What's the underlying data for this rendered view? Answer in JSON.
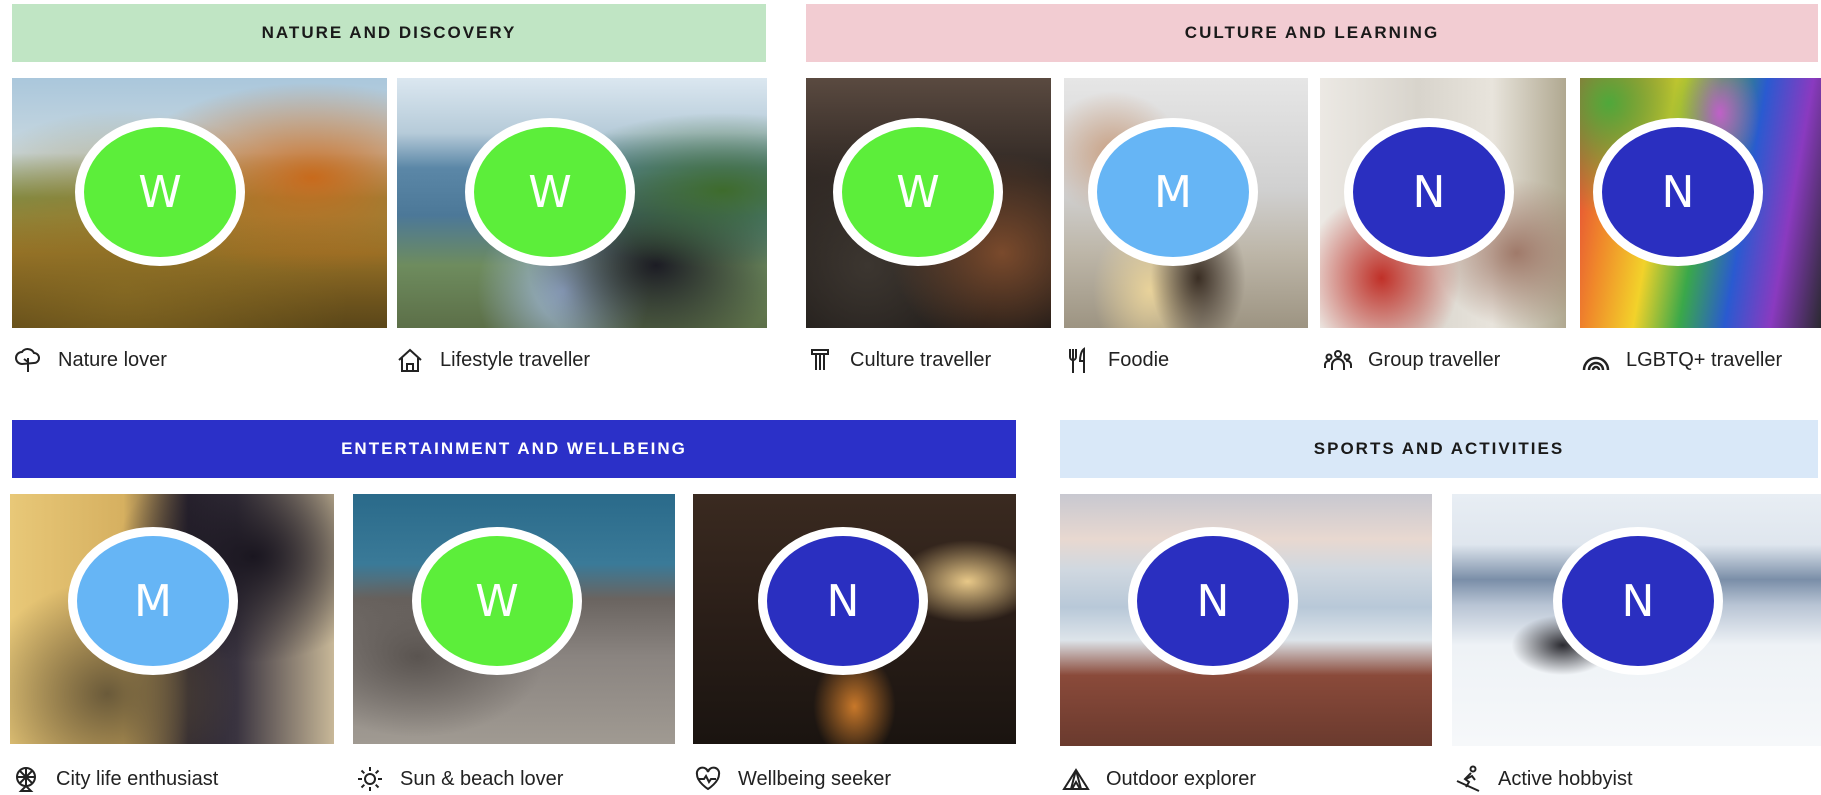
{
  "colors": {
    "nature_banner": "#c0e5c4",
    "culture_banner": "#f2ccd2",
    "entertainment_banner": "#2b30c8",
    "sports_banner": "#d9e8f8",
    "badge_W": "#5cee3a",
    "badge_M": "#66b5f5",
    "badge_N": "#2a2fc0"
  },
  "categories": {
    "nature": "NATURE AND DISCOVERY",
    "culture": "CULTURE AND LEARNING",
    "entertainment": "ENTERTAINMENT AND WELLBEING",
    "sports": "SPORTS AND ACTIVITIES"
  },
  "travellers": [
    {
      "label": "Nature lover",
      "badge": "W",
      "icon": "tree-icon",
      "photo": "autumn lakeside bench"
    },
    {
      "label": "Lifestyle traveller",
      "badge": "W",
      "icon": "house-icon",
      "photo": "couple selfie by sea"
    },
    {
      "label": "Culture traveller",
      "badge": "W",
      "icon": "column-icon",
      "photo": "theatre audience"
    },
    {
      "label": "Foodie",
      "badge": "M",
      "icon": "fork-knife-icon",
      "photo": "dining table"
    },
    {
      "label": "Group traveller",
      "badge": "N",
      "icon": "group-icon",
      "photo": "friends in street"
    },
    {
      "label": "LGBTQ+ traveller",
      "badge": "N",
      "icon": "rainbow-icon",
      "photo": "pride parade"
    },
    {
      "label": "City life enthusiast",
      "badge": "M",
      "icon": "ferris-wheel-icon",
      "photo": "evening city street"
    },
    {
      "label": "Sun & beach lover",
      "badge": "W",
      "icon": "sun-icon",
      "photo": "rocky seashore"
    },
    {
      "label": "Wellbeing seeker",
      "badge": "N",
      "icon": "heart-pulse-icon",
      "photo": "sauna yoga"
    },
    {
      "label": "Outdoor explorer",
      "badge": "N",
      "icon": "tent-icon",
      "photo": "fell above clouds"
    },
    {
      "label": "Active hobbyist",
      "badge": "N",
      "icon": "skier-icon",
      "photo": "downhill skier"
    }
  ]
}
